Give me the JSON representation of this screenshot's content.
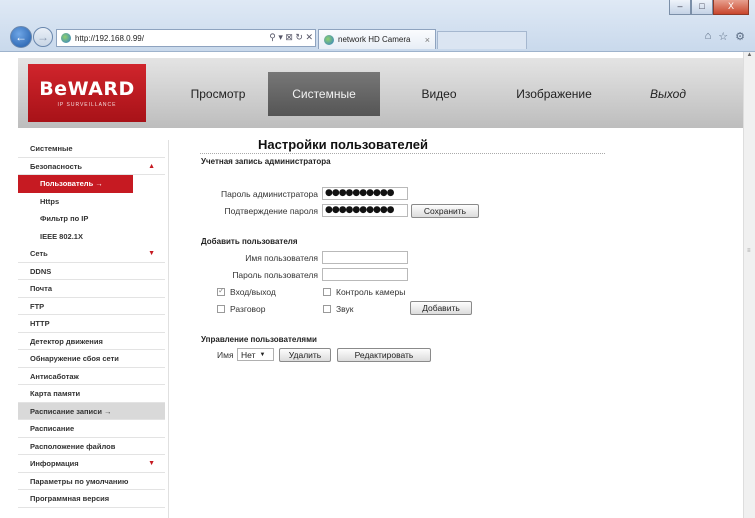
{
  "browser": {
    "address": "http://192.168.0.99/",
    "tab_title": "network HD Camera",
    "tab_close": "×",
    "addr_tools": "⚲ ▾ ⊠ ↻ ✕",
    "window_buttons": {
      "minimize": "–",
      "maximize": "□",
      "close": "X"
    }
  },
  "header": {
    "logo_main": "BeWARD",
    "logo_sub": "IP SURVEILLANCE",
    "menu": [
      {
        "label": "Просмотр"
      },
      {
        "label": "Системные"
      },
      {
        "label": "Видео"
      },
      {
        "label": "Изображение"
      },
      {
        "label": "Выход"
      }
    ]
  },
  "sidebar": {
    "items": [
      {
        "label": "Системные"
      },
      {
        "label": "Безопасность",
        "arrow": "▲"
      },
      {
        "label": "Пользователь →"
      },
      {
        "label": "Https"
      },
      {
        "label": "Фильтр по IP"
      },
      {
        "label": "IEEE 802.1X"
      },
      {
        "label": "Сеть",
        "arrow": "▼"
      },
      {
        "label": "DDNS"
      },
      {
        "label": "Почта"
      },
      {
        "label": "FTP"
      },
      {
        "label": "HTTP"
      },
      {
        "label": "Детектор движения"
      },
      {
        "label": "Обнаружение сбоя сети"
      },
      {
        "label": "Антисаботаж"
      },
      {
        "label": "Карта памяти"
      },
      {
        "label": "Расписание записи →"
      },
      {
        "label": "Расписание"
      },
      {
        "label": "Расположение файлов"
      },
      {
        "label": "Информация",
        "arrow": "▼"
      },
      {
        "label": "Параметры по умолчанию"
      },
      {
        "label": "Программная версия"
      }
    ]
  },
  "content": {
    "title": "Настройки пользователей",
    "admin": {
      "section": "Учетная запись администратора",
      "password_label": "Пароль администратора",
      "password_value": "●●●●●●●●●●",
      "confirm_label": "Подтверждение пароля",
      "confirm_value": "●●●●●●●●●●",
      "save_label": "Сохранить"
    },
    "add_user": {
      "section": "Добавить пользователя",
      "name_label": "Имя пользователя",
      "password_label": "Пароль пользователя",
      "login_logout": "Вход/выход",
      "camera_control": "Контроль камеры",
      "talk": "Разговор",
      "sound": "Звук",
      "add_label": "Добавить"
    },
    "manage": {
      "section": "Управление пользователями",
      "name_label": "Имя",
      "name_select": "Нет",
      "delete_label": "Удалить",
      "edit_label": "Редактировать"
    }
  }
}
